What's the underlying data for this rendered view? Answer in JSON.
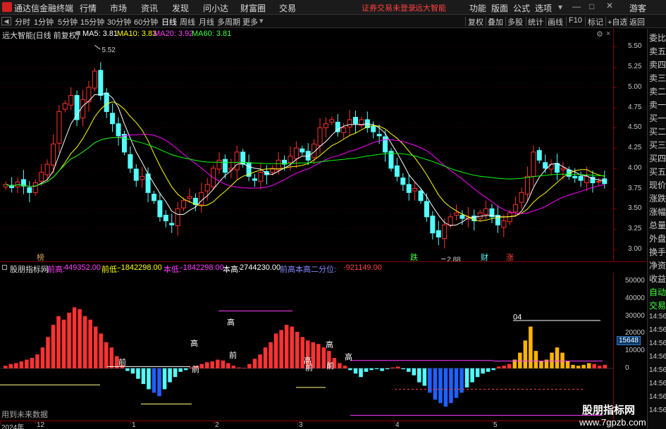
{
  "titlebar": {
    "app_name": "通达信金融终端",
    "menus": [
      "行情",
      "市场",
      "资讯",
      "发现",
      "问小达",
      "财富圈",
      "交易"
    ],
    "warning": "证券交易未登录",
    "stock_name": "远大智能",
    "right_menus": [
      "功能",
      "版面",
      "公式",
      "选项"
    ],
    "user": "游客"
  },
  "periodbar": {
    "tabs": [
      "分时",
      "1分钟",
      "5分钟",
      "15分钟",
      "30分钟",
      "60分钟",
      "日线",
      "周线",
      "月线",
      "多周期",
      "更多"
    ],
    "active_tab": "日线",
    "right_tabs": [
      "复权",
      "叠加",
      "多股",
      "统计",
      "画线",
      "F10",
      "标记",
      "+自选",
      "返回"
    ]
  },
  "main_info": {
    "title": "远大智能(日线 前复权)",
    "ma5": "MA5: 3.81",
    "ma10": "MA10: 3.83",
    "ma20": "MA20: 3.92",
    "ma60": "MA60: 3.81",
    "high_label": "5.52",
    "low_label": "2.88",
    "marker_labels": [
      "榜",
      "跌",
      "财",
      "涨"
    ]
  },
  "price_axis": [
    "5.50",
    "5.25",
    "5.00",
    "4.75",
    "4.50",
    "4.25",
    "4.00",
    "3.75",
    "3.50",
    "3.25",
    "3.00"
  ],
  "side_panel": [
    "委比",
    "卖五",
    "卖四",
    "卖三",
    "卖二",
    "卖一",
    "买一",
    "买二",
    "买三",
    "买四",
    "买五",
    "现价",
    "涨跌",
    "涨幅",
    "总量",
    "外盘",
    "换手",
    "净资",
    "收益",
    "自动",
    "交易",
    "14:56",
    "14:56",
    "14:56",
    "14:56",
    "14:56",
    "14:56",
    "14:56",
    "14:56"
  ],
  "indicator_info": {
    "name": "股朋指标网",
    "f1_label": "前高:",
    "f1_value": "449352.00",
    "f2_label": "前低:",
    "f2_value": "-1842298.00",
    "f3_label": "本低:",
    "f3_value": "-1842298.00",
    "f4_label": "本高:",
    "f4_value": "2744230.00",
    "f5_label": "前高本高二分位:",
    "f5_value": "-921149.00",
    "future_note": "用到未来数据"
  },
  "indicator_axis": [
    "50000",
    "40000",
    "30000",
    "20000",
    "10000",
    "0"
  ],
  "indicator_badge": "15648",
  "indicator_marks": [
    "前",
    "高",
    "前",
    "高",
    "前",
    "高",
    "前",
    "高",
    "前",
    "高",
    "04"
  ],
  "time_axis": [
    "2024年",
    "12",
    "1",
    "2",
    "3",
    "4",
    "5"
  ],
  "watermark": {
    "title": "股朋指标网",
    "url": "www.7gpzb.com"
  },
  "colors": {
    "up": "#ff3232",
    "down": "#54ffff",
    "ma5": "#ffffff",
    "ma10": "#ffff00",
    "ma20": "#ff00ff",
    "ma60": "#00ff00",
    "background": "#000000"
  },
  "chart_data": {
    "type": "candlestick",
    "ylim": [
      2.85,
      5.6
    ],
    "candles_close": [
      3.8,
      3.76,
      3.83,
      3.78,
      3.7,
      3.82,
      3.95,
      4.05,
      4.3,
      4.7,
      4.8,
      4.9,
      4.6,
      4.85,
      5.0,
      5.2,
      4.9,
      4.7,
      4.55,
      4.4,
      4.2,
      4.0,
      3.85,
      3.9,
      3.7,
      3.6,
      3.4,
      3.35,
      3.3,
      3.5,
      3.6,
      3.65,
      3.55,
      3.7,
      3.8,
      4.0,
      4.1,
      3.95,
      4.0,
      4.2,
      4.05,
      3.9,
      3.85,
      3.95,
      3.92,
      4.0,
      4.1,
      4.05,
      4.15,
      4.25,
      4.2,
      4.1,
      4.3,
      4.5,
      4.55,
      4.6,
      4.45,
      4.5,
      4.6,
      4.55,
      4.6,
      4.5,
      4.45,
      4.4,
      4.2,
      4.0,
      3.9,
      3.8,
      3.7,
      3.75,
      3.6,
      3.4,
      3.2,
      3.15,
      3.3,
      3.4,
      3.45,
      3.38,
      3.4,
      3.35,
      3.45,
      3.5,
      3.4,
      3.3,
      3.35,
      3.45,
      3.55,
      3.7,
      3.9,
      4.2,
      4.1,
      4.0,
      4.05,
      3.95,
      4.0,
      3.9,
      3.88,
      3.85,
      3.9,
      3.82,
      3.84,
      3.81
    ],
    "ma_labels": [
      "MA5",
      "MA10",
      "MA20",
      "MA60"
    ],
    "indicator": {
      "ylim": [
        -30000,
        55000
      ],
      "values": [
        1500,
        2500,
        3000,
        4000,
        5000,
        6000,
        8000,
        12000,
        18000,
        25000,
        30000,
        28000,
        32000,
        35000,
        34000,
        30000,
        28000,
        24000,
        20000,
        15000,
        12000,
        7000,
        2000,
        -1500,
        -3000,
        -6000,
        -9000,
        -12000,
        -14000,
        -16000,
        -12000,
        -8000,
        -5000,
        -2000,
        -1000,
        500,
        1500,
        2500,
        3500,
        4000,
        5000,
        4500,
        3000,
        1500,
        500,
        300,
        2500,
        5500,
        8000,
        12000,
        15000,
        20000,
        22000,
        25000,
        24000,
        21000,
        18000,
        16000,
        15000,
        14000,
        12000,
        10000,
        6000,
        3000,
        1500,
        -1000,
        -3000,
        -5000,
        -2000,
        -1000,
        -500,
        -1500,
        -500,
        500,
        1000,
        -500,
        -2000,
        -4000,
        -8000,
        -10000,
        -14000,
        -18000,
        -20000,
        -22000,
        -20000,
        -17000,
        -14000,
        -11000,
        -8000,
        -5000,
        -3000,
        -2000,
        -1000,
        1000,
        1500,
        2500,
        5000,
        9000,
        16000,
        24000,
        10000,
        4000,
        5000,
        9000,
        12000,
        9000,
        4000,
        2000,
        1500,
        2000,
        3000,
        2500,
        1500,
        2000
      ]
    }
  }
}
